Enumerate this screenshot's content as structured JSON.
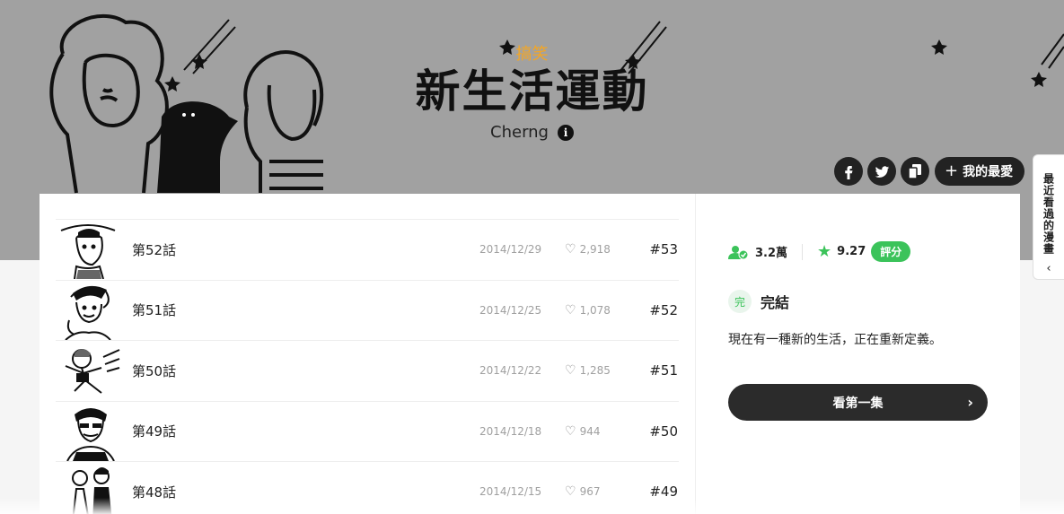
{
  "header": {
    "genre": "搞笑",
    "title": "新生活運動",
    "author": "Cherng",
    "info_icon": "info-icon",
    "colors": {
      "banner": "#a1a1a1",
      "genre": "#f5a623"
    }
  },
  "actions": {
    "facebook_icon": "facebook-icon",
    "twitter_icon": "twitter-icon",
    "copy_icon": "copy-link-icon",
    "favorite_label": "我的最愛"
  },
  "recent_tab": {
    "label": "最近看過的漫畫",
    "chevron": "‹"
  },
  "episodes": [
    {
      "title": "第52話",
      "date": "2014/12/29",
      "likes": "2,918",
      "number": "#53"
    },
    {
      "title": "第51話",
      "date": "2014/12/25",
      "likes": "1,078",
      "number": "#52"
    },
    {
      "title": "第50話",
      "date": "2014/12/22",
      "likes": "1,285",
      "number": "#51"
    },
    {
      "title": "第49話",
      "date": "2014/12/18",
      "likes": "944",
      "number": "#50"
    },
    {
      "title": "第48話",
      "date": "2014/12/15",
      "likes": "967",
      "number": "#49"
    }
  ],
  "sidebar": {
    "subscribers": "3.2萬",
    "rating": "9.27",
    "rate_label": "評分",
    "status_icon_text": "完",
    "status": "完結",
    "description": "現在有一種新的生活，正在重新定義。",
    "read_first_label": "看第一集",
    "accent": "#3bc35a"
  }
}
